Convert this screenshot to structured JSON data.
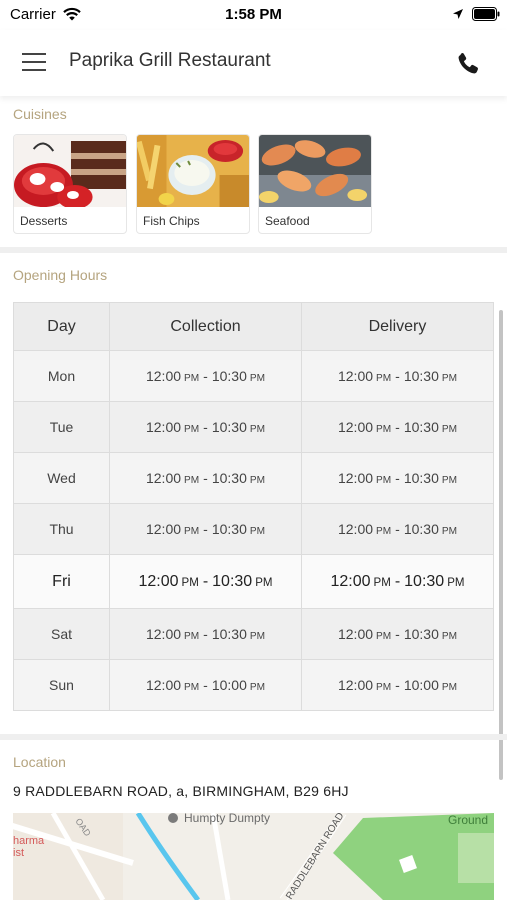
{
  "status_bar": {
    "carrier": "Carrier",
    "time": "1:58 PM"
  },
  "header": {
    "title": "Paprika Grill Restaurant",
    "menu_icon": "hamburger-menu-icon",
    "phone_icon": "phone-icon"
  },
  "cuisines": {
    "label": "Cuisines",
    "items": [
      {
        "label": "Desserts"
      },
      {
        "label": "Fish  Chips"
      },
      {
        "label": "Seafood"
      }
    ]
  },
  "opening_hours": {
    "label": "Opening Hours",
    "columns": [
      "Day",
      "Collection",
      "Delivery"
    ],
    "rows": [
      {
        "day": "Mon",
        "collection": {
          "open": "12:00",
          "open_ampm": "PM",
          "close": "10:30",
          "close_ampm": "PM"
        },
        "delivery": {
          "open": "12:00",
          "open_ampm": "PM",
          "close": "10:30",
          "close_ampm": "PM"
        }
      },
      {
        "day": "Tue",
        "collection": {
          "open": "12:00",
          "open_ampm": "PM",
          "close": "10:30",
          "close_ampm": "PM"
        },
        "delivery": {
          "open": "12:00",
          "open_ampm": "PM",
          "close": "10:30",
          "close_ampm": "PM"
        }
      },
      {
        "day": "Wed",
        "collection": {
          "open": "12:00",
          "open_ampm": "PM",
          "close": "10:30",
          "close_ampm": "PM"
        },
        "delivery": {
          "open": "12:00",
          "open_ampm": "PM",
          "close": "10:30",
          "close_ampm": "PM"
        }
      },
      {
        "day": "Thu",
        "collection": {
          "open": "12:00",
          "open_ampm": "PM",
          "close": "10:30",
          "close_ampm": "PM"
        },
        "delivery": {
          "open": "12:00",
          "open_ampm": "PM",
          "close": "10:30",
          "close_ampm": "PM"
        }
      },
      {
        "day": "Fri",
        "collection": {
          "open": "12:00",
          "open_ampm": "PM",
          "close": "10:30",
          "close_ampm": "PM"
        },
        "delivery": {
          "open": "12:00",
          "open_ampm": "PM",
          "close": "10:30",
          "close_ampm": "PM"
        }
      },
      {
        "day": "Sat",
        "collection": {
          "open": "12:00",
          "open_ampm": "PM",
          "close": "10:30",
          "close_ampm": "PM"
        },
        "delivery": {
          "open": "12:00",
          "open_ampm": "PM",
          "close": "10:30",
          "close_ampm": "PM"
        }
      },
      {
        "day": "Sun",
        "collection": {
          "open": "12:00",
          "open_ampm": "PM",
          "close": "10:00",
          "close_ampm": "PM"
        },
        "delivery": {
          "open": "12:00",
          "open_ampm": "PM",
          "close": "10:00",
          "close_ampm": "PM"
        }
      }
    ],
    "separator": "-"
  },
  "location": {
    "label": "Location",
    "address": "9 RADDLEBARN ROAD, a, BIRMINGHAM, B29 6HJ",
    "map": {
      "poi_humpty": "Humpty Dumpty",
      "poi_pharma": "harma",
      "poi_pharma_2": "ist",
      "poi_ground": "Ground",
      "road_raddlebarn": "RADDLEBARN ROAD",
      "road_small": "OAD"
    }
  },
  "colors": {
    "section_label": "#b5a47f",
    "map_green": "#8fd27f",
    "map_water": "#59c6ee"
  }
}
